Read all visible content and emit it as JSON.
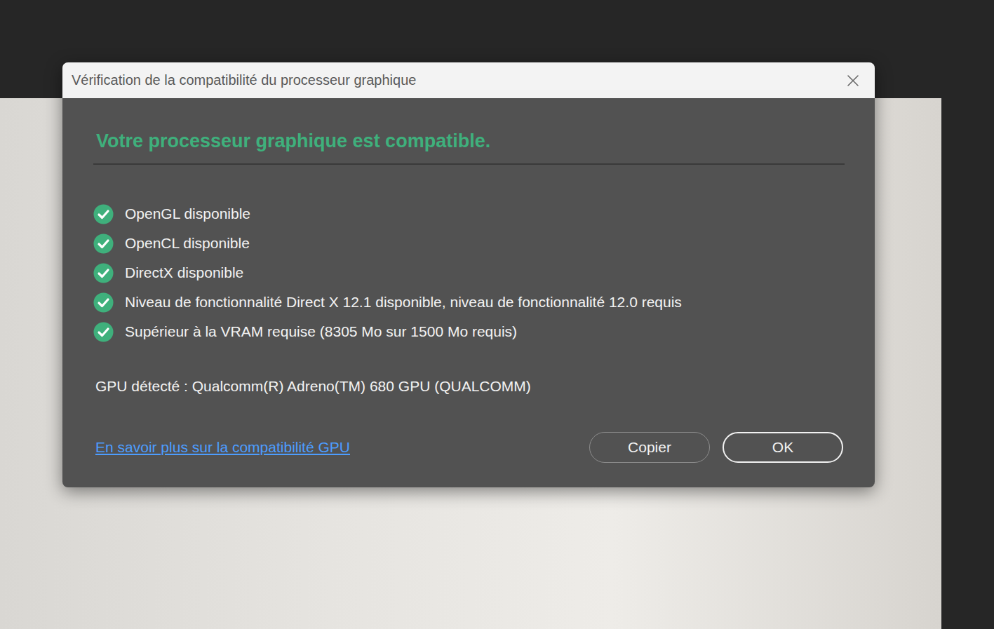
{
  "window": {
    "title": "Vérification de la compatibilité du processeur graphique"
  },
  "heading": "Votre processeur graphique est compatible.",
  "checks": [
    {
      "label": "OpenGL disponible",
      "checked": true
    },
    {
      "label": "OpenCL disponible",
      "checked": true
    },
    {
      "label": "DirectX disponible",
      "checked": true
    },
    {
      "label": "Niveau de fonctionnalité Direct X 12.1 disponible, niveau de fonctionnalité 12.0 requis",
      "checked": true
    },
    {
      "label": "Supérieur à la VRAM requise (8305 Mo sur 1500 Mo requis)",
      "checked": true
    }
  ],
  "gpu": "GPU détecté : Qualcomm(R) Adreno(TM) 680 GPU (QUALCOMM)",
  "link": "En savoir plus sur la compatibilité GPU",
  "buttons": [
    {
      "label": "Copier",
      "primary": false
    },
    {
      "label": "OK",
      "primary": true
    }
  ]
}
